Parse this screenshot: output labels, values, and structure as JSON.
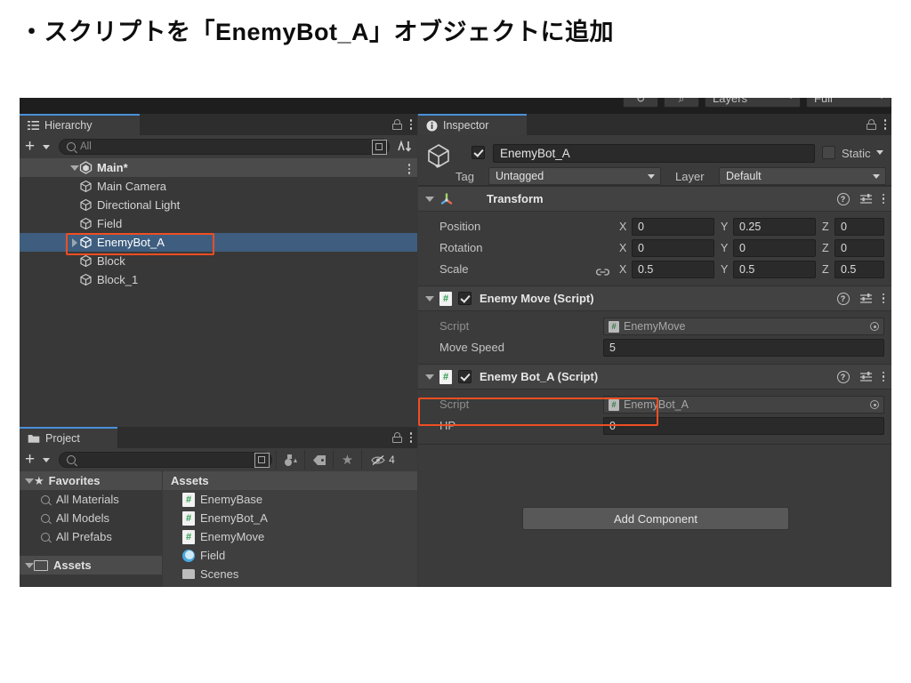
{
  "slide": {
    "title": "・スクリプトを「EnemyBot_A」オブジェクトに追加"
  },
  "colors": {
    "highlight": "#f04e23",
    "selection": "#3f5e7f",
    "panel_bg": "#383838",
    "inspector_bg": "#3b3b3b",
    "accent_tab": "#4a90d9"
  },
  "toolbar_strip": {
    "layers_label": "Layers",
    "layout_label": "Full",
    "refresh_icon": "refresh-icon",
    "search_icon": "search-icon"
  },
  "hierarchy": {
    "tab_label": "Hierarchy",
    "tab_icon": "hierarchy-icon",
    "lock_icon": "lock-icon",
    "menu_icon": "kebab-menu-icon",
    "add_label": "+",
    "search_placeholder": "All",
    "search_value": "",
    "expand_icon": "expand-window-icon",
    "sort_icon": "sort-icon",
    "items": [
      {
        "label": "Main*",
        "depth": 0,
        "icon": "unity-scene-icon",
        "caret": "down",
        "selected": false,
        "scene": true
      },
      {
        "label": "Main Camera",
        "depth": 1,
        "icon": "gameobject-cube-icon",
        "caret": "none",
        "selected": false,
        "scene": false
      },
      {
        "label": "Directional Light",
        "depth": 1,
        "icon": "gameobject-cube-icon",
        "caret": "none",
        "selected": false,
        "scene": false
      },
      {
        "label": "Field",
        "depth": 1,
        "icon": "gameobject-cube-icon",
        "caret": "none",
        "selected": false,
        "scene": false
      },
      {
        "label": "EnemyBot_A",
        "depth": 1,
        "icon": "gameobject-cube-icon",
        "caret": "right",
        "selected": true,
        "scene": false
      },
      {
        "label": "Block",
        "depth": 1,
        "icon": "gameobject-cube-icon",
        "caret": "none",
        "selected": false,
        "scene": false
      },
      {
        "label": "Block_1",
        "depth": 1,
        "icon": "gameobject-cube-icon",
        "caret": "none",
        "selected": false,
        "scene": false
      }
    ]
  },
  "project": {
    "tab_label": "Project",
    "tab_icon": "folder-icon",
    "lock_icon": "lock-icon",
    "menu_icon": "kebab-menu-icon",
    "add_label": "+",
    "search_placeholder": "",
    "search_value": "",
    "tools": [
      {
        "name": "expand-window-icon",
        "glyph": "⧉"
      },
      {
        "name": "asset-type-filter-icon",
        "glyph": "◑"
      },
      {
        "name": "label-tag-filter-icon",
        "glyph": "🏷"
      },
      {
        "name": "favorite-star-filter-icon",
        "glyph": "★"
      },
      {
        "name": "hidden-packages-icon",
        "glyph": "⦸",
        "badge": "4"
      }
    ],
    "tree": [
      {
        "label": "Favorites",
        "icon": "star-icon",
        "caret": "down",
        "depth": 0,
        "header": true
      },
      {
        "label": "All Materials",
        "icon": "search-icon",
        "caret": "none",
        "depth": 1,
        "header": false
      },
      {
        "label": "All Models",
        "icon": "search-icon",
        "caret": "none",
        "depth": 1,
        "header": false
      },
      {
        "label": "All Prefabs",
        "icon": "search-icon",
        "caret": "none",
        "depth": 1,
        "header": false
      },
      {
        "label": "Assets",
        "icon": "folder-open-icon",
        "caret": "down",
        "depth": 0,
        "header": true
      }
    ],
    "assets_header": "Assets",
    "assets": [
      {
        "label": "EnemyBase",
        "icon": "csharp-script-icon"
      },
      {
        "label": "EnemyBot_A",
        "icon": "csharp-script-icon"
      },
      {
        "label": "EnemyMove",
        "icon": "csharp-script-icon"
      },
      {
        "label": "Field",
        "icon": "material-icon"
      },
      {
        "label": "Scenes",
        "icon": "folder-icon"
      }
    ]
  },
  "inspector": {
    "tab_label": "Inspector",
    "tab_icon": "info-icon",
    "lock_icon": "lock-icon",
    "menu_icon": "kebab-menu-icon",
    "object": {
      "icon": "gameobject-cube-icon",
      "enabled": true,
      "name": "EnemyBot_A",
      "static_label": "Static",
      "static_checked": false,
      "tag_label": "Tag",
      "tag_value": "Untagged",
      "layer_label": "Layer",
      "layer_value": "Default"
    },
    "components": [
      {
        "title": "Transform",
        "icon": "transform-axis-icon",
        "has_checkbox": false,
        "enabled": true,
        "expanded": true,
        "highlighted": false,
        "vector_rows": [
          {
            "label": "Position",
            "x": "0",
            "y": "0.25",
            "z": "0",
            "link": false
          },
          {
            "label": "Rotation",
            "x": "0",
            "y": "0",
            "z": "0",
            "link": false
          },
          {
            "label": "Scale",
            "x": "0.5",
            "y": "0.5",
            "z": "0.5",
            "link": true
          }
        ],
        "fields": []
      },
      {
        "title": "Enemy Move (Script)",
        "icon": "csharp-script-icon",
        "has_checkbox": true,
        "enabled": true,
        "expanded": true,
        "highlighted": false,
        "vector_rows": [],
        "fields": [
          {
            "label": "Script",
            "value": "EnemyMove",
            "type": "object",
            "dim": true
          },
          {
            "label": "Move Speed",
            "value": "5",
            "type": "number",
            "dim": false
          }
        ]
      },
      {
        "title": "Enemy Bot_A (Script)",
        "icon": "csharp-script-icon",
        "has_checkbox": true,
        "enabled": true,
        "expanded": true,
        "highlighted": true,
        "vector_rows": [],
        "fields": [
          {
            "label": "Script",
            "value": "EnemyBot_A",
            "type": "object",
            "dim": true
          },
          {
            "label": "HP",
            "value": "0",
            "type": "number",
            "dim": false
          }
        ]
      }
    ],
    "add_component_label": "Add Component",
    "component_header_icons": {
      "help": "help-icon",
      "preset": "preset-settings-icon",
      "menu": "kebab-menu-icon"
    }
  }
}
